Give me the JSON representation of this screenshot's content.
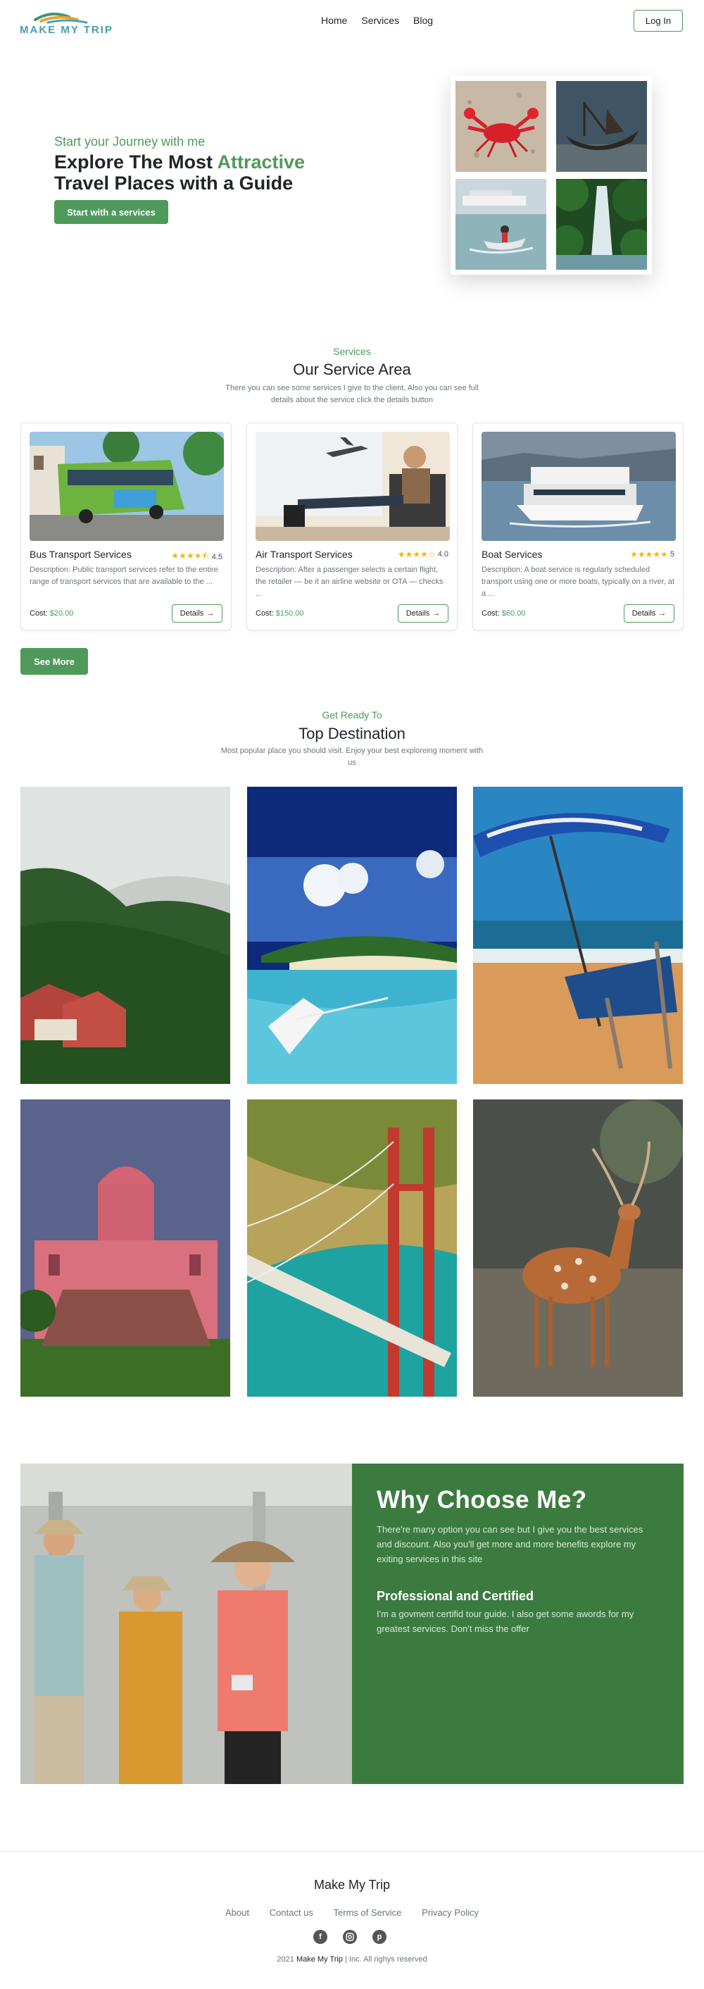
{
  "brand": {
    "logo_text": "MAKE MY TRIP"
  },
  "nav": {
    "links": [
      "Home",
      "Services",
      "Blog"
    ],
    "login_label": "Log In"
  },
  "hero": {
    "subtitle": "Start your Journey with me",
    "title_part1": "Explore The Most ",
    "title_accent": "Attractive",
    "title_part2": "Travel Places with a Guide",
    "cta_label": "Start with a services"
  },
  "services": {
    "kicker": "Services",
    "title": "Our Service Area",
    "description": "There you can see some services I give to the client, Also you can see full details about the service click the details button",
    "cards": [
      {
        "title": "Bus Transport Services",
        "rating": "4.5",
        "stars": "★★★★⯪",
        "description": "Description: Public transport services refer to the entire range of transport services that are available to the ...",
        "cost_label": "Cost:",
        "price": "$20.00",
        "details_label": "Details"
      },
      {
        "title": "Air Transport Services",
        "rating": "4.0",
        "stars": "★★★★☆",
        "description": "Description: After a passenger selects a certain flight, the retailer — be it an airline website or OTA — checks ...",
        "cost_label": "Cost:",
        "price": "$150.00",
        "details_label": "Details"
      },
      {
        "title": "Boat Services",
        "rating": "5",
        "stars": "★★★★★",
        "description": "Description: A boat service is regularly scheduled transport using one or more boats, typically on a river, at a ...",
        "cost_label": "Cost:",
        "price": "$60.00",
        "details_label": "Details"
      }
    ],
    "see_more_label": "See More"
  },
  "destinations": {
    "kicker": "Get Ready To",
    "title": "Top Destination",
    "description": "Most popular place you should visit. Enjoy your best exploreing moment with us"
  },
  "why": {
    "title": "Why Choose Me?",
    "description": "There're many option you can see but I give you the best services and discount. Also you'll get more and more benefits explore my exiting services in this site",
    "subtitle": "Professional and Certified",
    "sub_description": "I'm a govment certifid tour guide. I also get some awords for my greatest services. Don't miss the offer"
  },
  "footer": {
    "title": "Make My Trip",
    "links": [
      "About",
      "Contact us",
      "Terms of Service",
      "Privacy Policy"
    ],
    "social_icons": [
      "facebook-icon",
      "instagram-icon",
      "pinterest-icon"
    ],
    "copy_year": "2021",
    "copy_brand": "Make My Trip",
    "copy_rest": "| Inc. All righys reserved"
  },
  "colors": {
    "accent": "#4f9a5b",
    "why_panel": "#3b7b40",
    "star": "#f5b800"
  }
}
